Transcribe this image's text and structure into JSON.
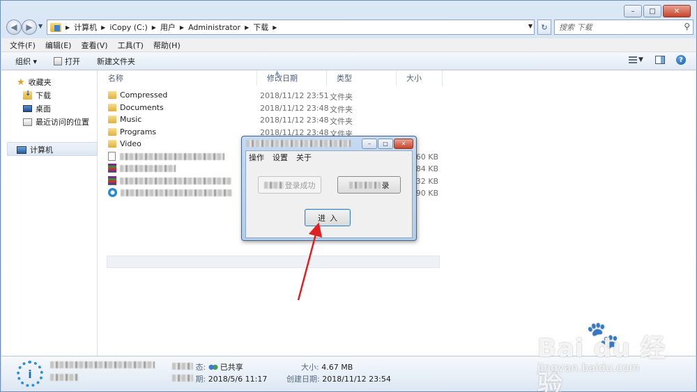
{
  "window": {
    "caption": {
      "minimize": "–",
      "maximize": "□",
      "close": "✕"
    }
  },
  "nav": {
    "back_glyph": "◀",
    "forward_glyph": "▶",
    "breadcrumbs": [
      "计算机",
      "iCopy (C:)",
      "用户",
      "Administrator",
      "下载"
    ],
    "search_placeholder": "搜索 下载",
    "refresh_glyph": "↻"
  },
  "menubar": [
    "文件(F)",
    "编辑(E)",
    "查看(V)",
    "工具(T)",
    "帮助(H)"
  ],
  "toolbar": {
    "organize": "组织 ▾",
    "open": "打开",
    "new_folder": "新建文件夹"
  },
  "sidebar": {
    "favorites": "收藏夹",
    "downloads": "下载",
    "desktop": "桌面",
    "recent": "最近访问的位置",
    "computer": "计算机"
  },
  "columns": {
    "name": "名称",
    "modified": "修改日期",
    "type": "类型",
    "size": "大小"
  },
  "files": [
    {
      "name": "Compressed",
      "date": "2018/11/12 23:51",
      "type": "文件夹"
    },
    {
      "name": "Documents",
      "date": "2018/11/12 23:48",
      "type": "文件夹"
    },
    {
      "name": "Music",
      "date": "2018/11/12 23:48",
      "type": "文件夹"
    },
    {
      "name": "Programs",
      "date": "2018/11/12 23:48",
      "type": "文件夹"
    },
    {
      "name": "Video",
      "date": "",
      "type": ""
    }
  ],
  "file_sizes": [
    "160 KB",
    "284 KB",
    "732 KB",
    "790 KB"
  ],
  "dialog": {
    "menu": [
      "操作",
      "设置",
      "关于"
    ],
    "login_success": "登录成功",
    "second_button_suffix": "录",
    "enter": "进入"
  },
  "details": {
    "share_label": "态:",
    "share_value": "已共享",
    "modified_label": "期:",
    "modified_value": "2018/5/6 11:17",
    "size_label": "大小:",
    "size_value": "4.67 MB",
    "created_label": "创建日期:",
    "created_value": "2018/11/12 23:54"
  },
  "watermark": {
    "main": "Bai  du 经验",
    "sub": "jingyan.baidu.com"
  },
  "colors": {
    "arrow": "#e02020",
    "accent": "#2a8fd6"
  }
}
